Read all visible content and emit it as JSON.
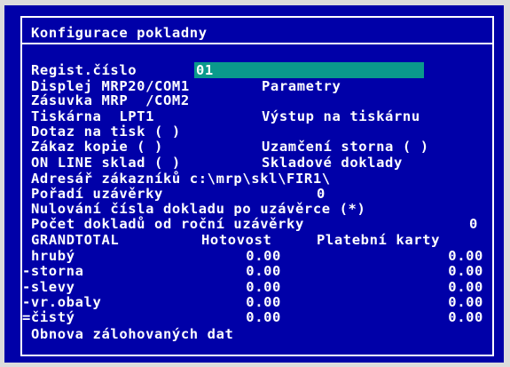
{
  "title": "Konfigurace pokladny",
  "regist": {
    "label": "Regist.číslo",
    "value": "01"
  },
  "rows": {
    "displej": "Displej MRP20/COM1",
    "parametry": "Parametry",
    "zasuvka": "Zásuvka MRP  /COM2",
    "tiskarna": "Tiskárna  LPT1",
    "vystup": "Výstup na tiskárnu",
    "dotaz": "Dotaz na tisk ( )",
    "zakaz": "Zákaz kopie ( )",
    "uzamceni": "Uzamčení storna ( )",
    "online": "ON LINE sklad ( )",
    "skladove": "Skladové doklady",
    "adresar": "Adresář zákazníků c:\\mrp\\skl\\FIR1\\",
    "poradi_label": "Pořadí uzávěrky",
    "poradi_value": "0",
    "nulovani": "Nulování čísla dokladu po uzávěrce (*)",
    "pocet_label": "Počet dokladů od roční uzávěrky",
    "pocet_value": "0"
  },
  "totals": {
    "header": {
      "label": "GRANDTOTAL",
      "col1": "Hotovost",
      "col2": "Platební karty"
    },
    "rows": [
      {
        "label": "hrubý",
        "hotovost": "0.00",
        "karty": "0.00"
      },
      {
        "label": "-storna",
        "hotovost": "0.00",
        "karty": "0.00"
      },
      {
        "label": "-slevy",
        "hotovost": "0.00",
        "karty": "0.00"
      },
      {
        "label": "-vr.obaly",
        "hotovost": "0.00",
        "karty": "0.00"
      },
      {
        "label": "=čistý",
        "hotovost": "0.00",
        "karty": "0.00"
      }
    ]
  },
  "obnova": "Obnova zálohovaných dat",
  "colors": {
    "background": "#0000a8",
    "text": "#ffffff",
    "field": "#0a9a8c",
    "outer": "#dcdcdc"
  }
}
